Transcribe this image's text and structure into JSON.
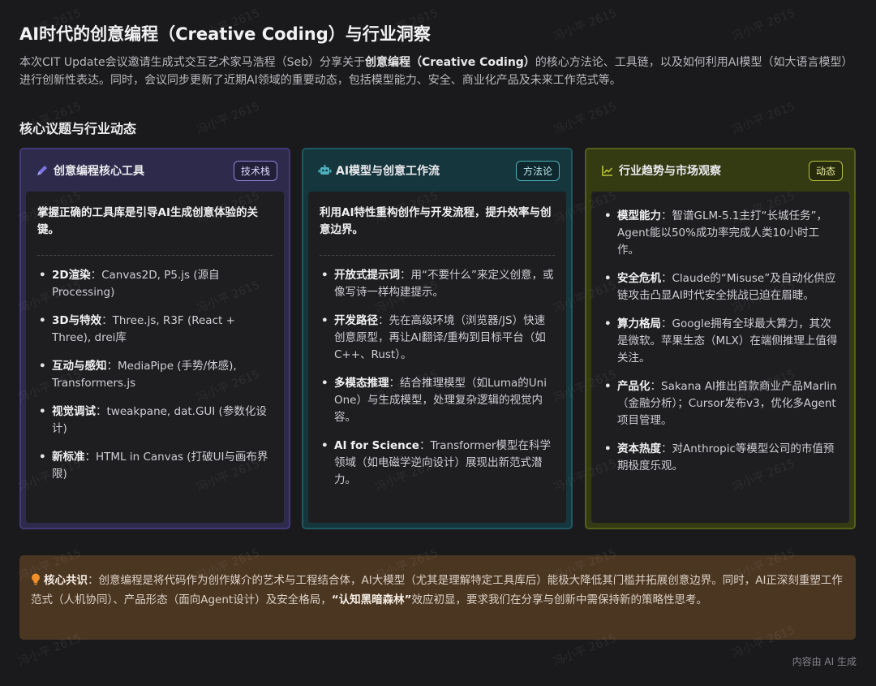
{
  "title": "AI时代的创意编程（Creative Coding）与行业洞察",
  "intro": {
    "pre": "本次CIT Update会议邀请生成式交互艺术家马浩程（Seb）分享关于",
    "bold": "创意编程（Creative Coding）",
    "post": "的核心方法论、工具链，以及如何利用AI模型（如大语言模型）进行创新性表达。同时，会议同步更新了近期AI领域的重要动态，包括模型能力、安全、商业化产品及未来工作范式等。"
  },
  "section_title": "核心议题与行业动态",
  "cards": [
    {
      "title": "创意编程核心工具",
      "tag": "技术栈",
      "icon": "pen-icon",
      "lead": "掌握正确的工具库是引导AI生成创意体验的关键。",
      "items": [
        {
          "label": "2D渲染",
          "text": "：Canvas2D, P5.js (源自Processing)"
        },
        {
          "label": "3D与特效",
          "text": "：Three.js, R3F (React + Three), drei库"
        },
        {
          "label": "互动与感知",
          "text": "：MediaPipe (手势/体感), Transformers.js"
        },
        {
          "label": "视觉调试",
          "text": "：tweakpane, dat.GUI (参数化设计)"
        },
        {
          "label": "新标准",
          "text": "：HTML in Canvas (打破UI与画布界限)"
        }
      ]
    },
    {
      "title": "AI模型与创意工作流",
      "tag": "方法论",
      "icon": "robot-icon",
      "lead": "利用AI特性重构创作与开发流程，提升效率与创意边界。",
      "items": [
        {
          "label": "开放式提示词",
          "text": "：用“不要什么”来定义创意，或像写诗一样构建提示。"
        },
        {
          "label": "开发路径",
          "text": "：先在高级环境（浏览器/JS）快速创意原型，再让AI翻译/重构到目标平台（如C++、Rust）。"
        },
        {
          "label": "多模态推理",
          "text": "：结合推理模型（如Luma的Uni One）与生成模型，处理复杂逻辑的视觉内容。"
        },
        {
          "label": "AI for Science",
          "text": "：Transformer模型在科学领域（如电磁学逆向设计）展现出新范式潜力。"
        }
      ]
    },
    {
      "title": "行业趋势与市场观察",
      "tag": "动态",
      "icon": "trend-chart-icon",
      "items": [
        {
          "label": "模型能力",
          "text": "：智谱GLM-5.1主打“长城任务”，Agent能以50%成功率完成人类10小时工作。"
        },
        {
          "label": "安全危机",
          "text": "：Claude的“Misuse”及自动化供应链攻击凸显AI时代安全挑战已迫在眉睫。"
        },
        {
          "label": "算力格局",
          "text": "：Google拥有全球最大算力，其次是微软。苹果生态（MLX）在端侧推理上值得关注。"
        },
        {
          "label": "产品化",
          "text": "：Sakana AI推出首款商业产品Marlin（金融分析）；Cursor发布v3，优化多Agent项目管理。"
        },
        {
          "label": "资本热度",
          "text": "：对Anthropic等模型公司的市值预期极度乐观。"
        }
      ]
    }
  ],
  "consensus": {
    "icon": "lightbulb-icon",
    "label": "核心共识",
    "text_a": "：创意编程是将代码作为创作媒介的艺术与工程结合体，AI大模型（尤其是理解特定工具库后）能极大降低其门槛并拓展创意边界。同时，AI正深刻重塑工作范式（人机协同）、产品形态（面向Agent设计）及安全格局，",
    "bold": "“认知黑暗森林”",
    "text_b": "效应初显，要求我们在分享与创新中需保持新的策略性思考。"
  },
  "footer": "内容由 AI 生成",
  "watermark": "冯小平 2615",
  "colors": {
    "background": "#1a1a1c",
    "card1_accent": "#7b74e0",
    "card2_accent": "#4cb0bd",
    "card3_accent": "#b8c43c",
    "consensus_bg": "#4b3622",
    "bulb": "#f0902a"
  }
}
